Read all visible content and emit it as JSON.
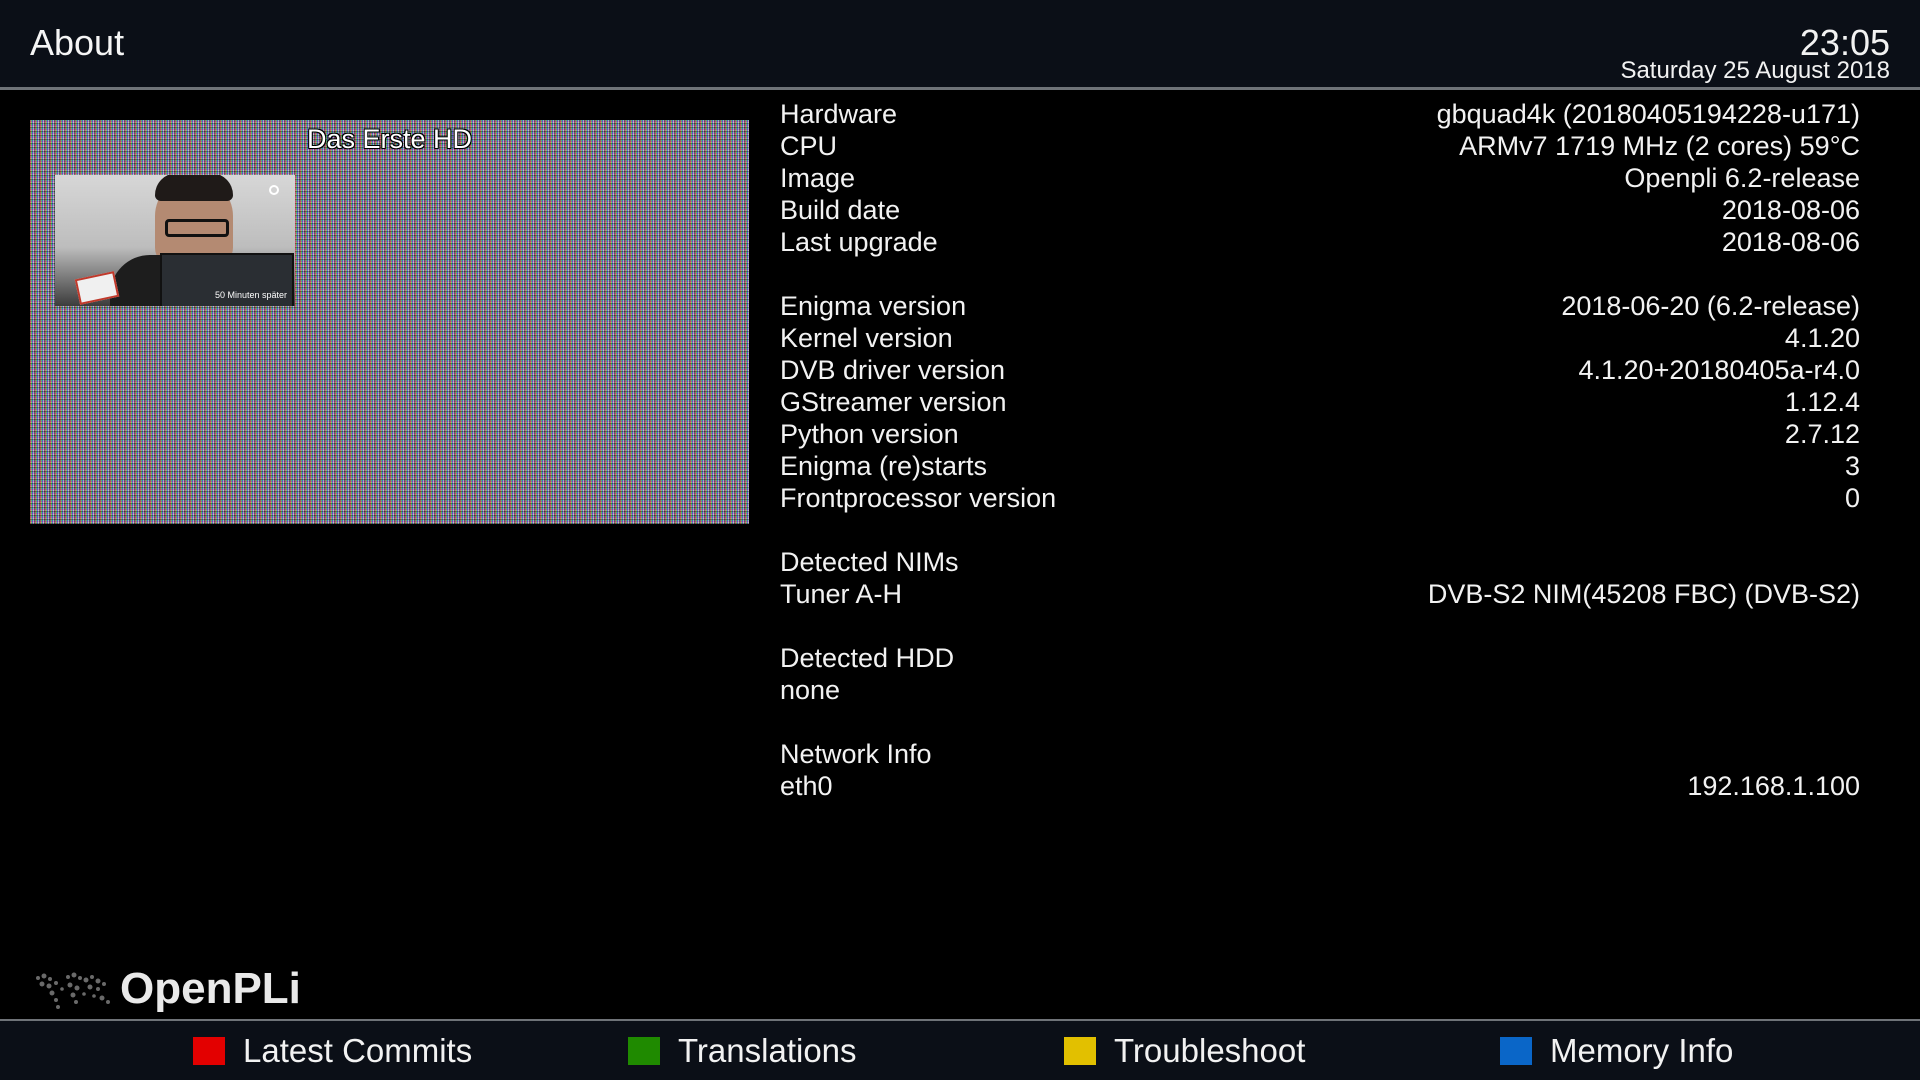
{
  "header": {
    "title": "About",
    "time": "23:05",
    "date": "Saturday 25 August 2018"
  },
  "preview": {
    "channel": "Das Erste HD",
    "inset_caption": "50 Minuten später"
  },
  "info": {
    "hardware": {
      "label": "Hardware",
      "value": "gbquad4k (20180405194228-u171)"
    },
    "cpu": {
      "label": "CPU",
      "value": "ARMv7 1719 MHz (2 cores) 59°C"
    },
    "image": {
      "label": "Image",
      "value": "Openpli 6.2-release"
    },
    "build_date": {
      "label": "Build date",
      "value": "2018-08-06"
    },
    "last_upgrade": {
      "label": "Last upgrade",
      "value": "2018-08-06"
    },
    "enigma_version": {
      "label": "Enigma version",
      "value": "2018-06-20 (6.2-release)"
    },
    "kernel_version": {
      "label": "Kernel version",
      "value": "4.1.20"
    },
    "dvb_driver_version": {
      "label": "DVB driver version",
      "value": "4.1.20+20180405a-r4.0"
    },
    "gstreamer_version": {
      "label": "GStreamer version",
      "value": "1.12.4"
    },
    "python_version": {
      "label": "Python version",
      "value": "2.7.12"
    },
    "enigma_restarts": {
      "label": "Enigma (re)starts",
      "value": "3"
    },
    "frontprocessor_version": {
      "label": "Frontprocessor version",
      "value": "0"
    },
    "nims_heading": "Detected NIMs",
    "tuner": {
      "label": "Tuner A-H",
      "value": "DVB-S2 NIM(45208 FBC) (DVB-S2)"
    },
    "hdd_heading": "Detected HDD",
    "hdd_value": "none",
    "network_heading": "Network Info",
    "eth0": {
      "label": "eth0",
      "value": "192.168.1.100"
    }
  },
  "logo": {
    "text": "OpenPLi",
    "icon": "globe-map-icon"
  },
  "footer": {
    "red": {
      "label": "Latest Commits",
      "color": "#e30000"
    },
    "green": {
      "label": "Translations",
      "color": "#1f8a00"
    },
    "yellow": {
      "label": "Troubleshoot",
      "color": "#e2c000"
    },
    "blue": {
      "label": "Memory Info",
      "color": "#0a66c8"
    }
  }
}
